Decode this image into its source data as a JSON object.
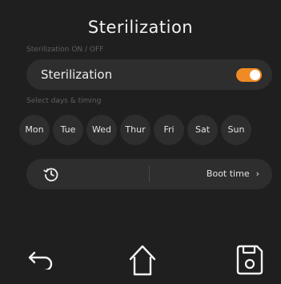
{
  "header": {
    "title": "Sterilization"
  },
  "sterilization_section": {
    "label": "Sterilization ON / OFF",
    "row_label": "Sterilization",
    "toggle_on": true,
    "toggle_color": "#f08a24"
  },
  "days_section": {
    "label": "Select days & timing",
    "days": [
      "Mon",
      "Tue",
      "Wed",
      "Thur",
      "Fri",
      "Sat",
      "Sun"
    ]
  },
  "timing": {
    "icon": "history-clock-icon",
    "value_label": "Boot time",
    "chevron": "›"
  },
  "bottom_nav": {
    "back_icon": "back-arrow-icon",
    "home_icon": "home-icon",
    "save_icon": "save-icon"
  }
}
